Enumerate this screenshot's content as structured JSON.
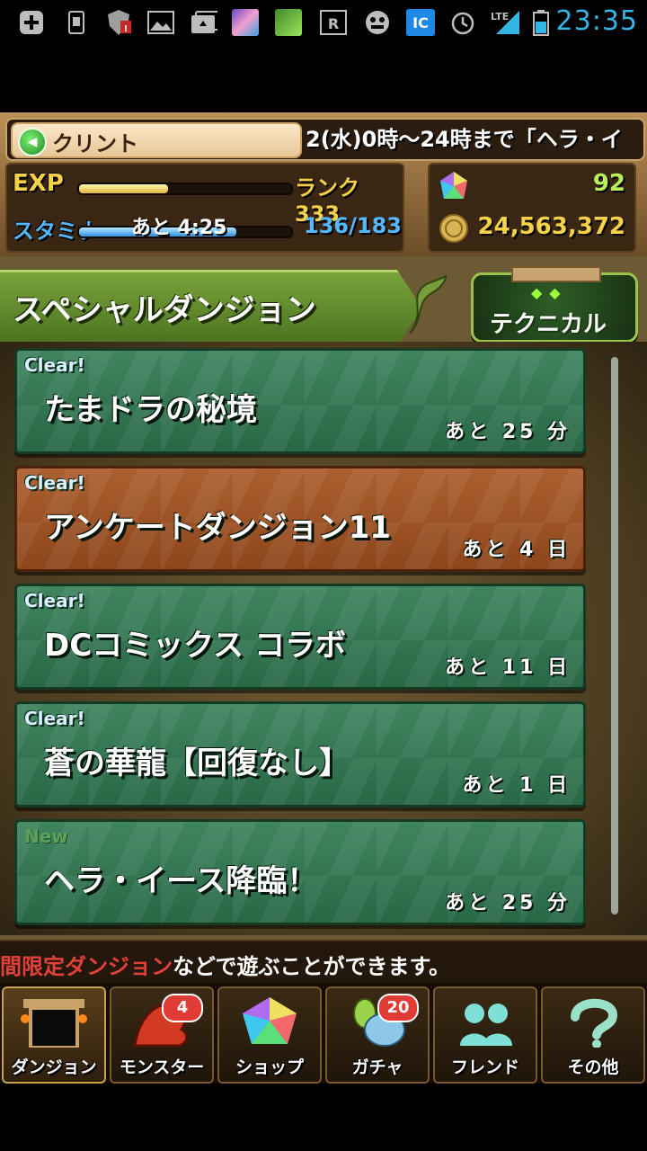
{
  "status_bar": {
    "time": "23:35",
    "network": "LTE",
    "icons": [
      "add-icon",
      "sim-icon",
      "shield-notify-icon",
      "image-icon",
      "upload-icon",
      "app-thumb-1",
      "app-thumb-2",
      "rakuten-icon",
      "game-notify-icon",
      "ic-card-icon",
      "alarm-icon",
      "signal-icon",
      "battery-icon"
    ],
    "ic_label": "IC",
    "r_label": "R"
  },
  "hud": {
    "player_name": "クリント",
    "marquee": "2(水)0時～24時まで「ヘラ・イ",
    "exp_label": "EXP",
    "rank_label": "ランク 333",
    "exp_progress": 0.42,
    "stamina_label": "スタミナ",
    "stamina_timer": "あと 4:25",
    "stamina_value": "136/183",
    "stamina_progress": 0.74,
    "magic_stones": "92",
    "coins": "24,563,372"
  },
  "section": {
    "title": "スペシャルダンジョン",
    "technical_label": "テクニカル"
  },
  "dungeons": [
    {
      "badge": "Clear!",
      "name": "たまドラの秘境",
      "remaining": "あと 25 分",
      "color": "green"
    },
    {
      "badge": "Clear!",
      "name": "アンケートダンジョン11",
      "remaining": "あと 4 日",
      "color": "brown"
    },
    {
      "badge": "Clear!",
      "name": "DCコミックス コラボ",
      "remaining": "あと 11 日",
      "color": "green"
    },
    {
      "badge": "Clear!",
      "name": "蒼の華龍【回復なし】",
      "remaining": "あと 1 日",
      "color": "green"
    },
    {
      "badge": "New",
      "name": "ヘラ・イース降臨！",
      "remaining": "あと 25 分",
      "color": "green"
    }
  ],
  "ticker": {
    "highlight": "間限定ダンジョン",
    "rest": "などで遊ぶことができます。"
  },
  "nav": [
    {
      "label": "ダンジョン",
      "icon": "dungeon-gate-icon",
      "badge": ""
    },
    {
      "label": "モンスター",
      "icon": "monster-icon",
      "badge": "4"
    },
    {
      "label": "ショップ",
      "icon": "gem-icon",
      "badge": ""
    },
    {
      "label": "ガチャ",
      "icon": "egg-icon",
      "badge": "20"
    },
    {
      "label": "フレンド",
      "icon": "friends-icon",
      "badge": ""
    },
    {
      "label": "その他",
      "icon": "question-icon",
      "badge": ""
    }
  ],
  "colors": {
    "status_time": "#33b5e5",
    "dungeon_green": "#2f7a52",
    "dungeon_brown": "#a5521f",
    "exp_text": "#f6d24a",
    "stamina_text": "#55b8ff",
    "stone_text": "#b7f05a",
    "coin_text": "#f6d24a"
  }
}
